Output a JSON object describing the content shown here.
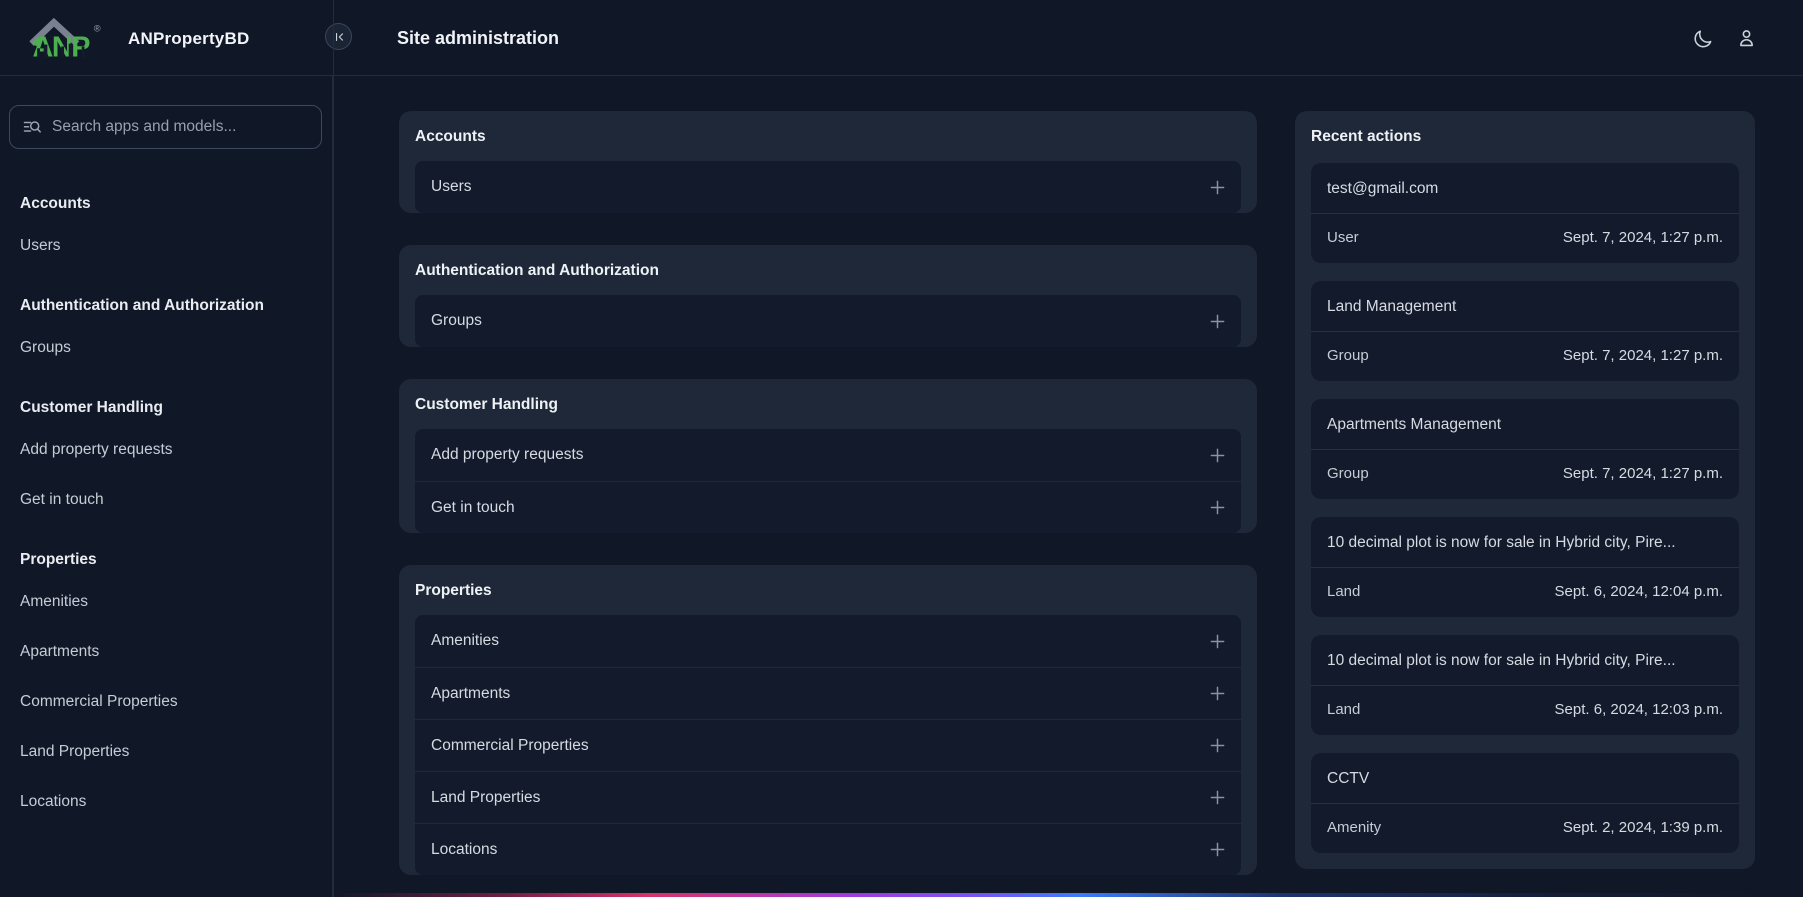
{
  "header": {
    "brand": "ANPropertyBD",
    "page_title": "Site administration",
    "icons": {
      "collapse": "collapse-sidebar",
      "theme": "moon",
      "account": "person"
    }
  },
  "logo": {
    "text": "ANP",
    "trademark": "®",
    "green": "#4caf50",
    "gray": "#7a8290"
  },
  "sidebar": {
    "search_placeholder": "Search apps and models...",
    "search_icon": "manage-search",
    "sections": [
      {
        "label": "Accounts",
        "items": [
          "Users"
        ]
      },
      {
        "label": "Authentication and Authorization",
        "items": [
          "Groups"
        ]
      },
      {
        "label": "Customer Handling",
        "items": [
          "Add property requests",
          "Get in touch"
        ]
      },
      {
        "label": "Properties",
        "items": [
          "Amenities",
          "Apartments",
          "Commercial Properties",
          "Land Properties",
          "Locations"
        ]
      }
    ]
  },
  "main": {
    "add_icon": "plus",
    "cards": [
      {
        "title": "Accounts",
        "rows": [
          "Users"
        ]
      },
      {
        "title": "Authentication and Authorization",
        "rows": [
          "Groups"
        ]
      },
      {
        "title": "Customer Handling",
        "rows": [
          "Add property requests",
          "Get in touch"
        ]
      },
      {
        "title": "Properties",
        "rows": [
          "Amenities",
          "Apartments",
          "Commercial Properties",
          "Land Properties",
          "Locations"
        ]
      }
    ]
  },
  "recent": {
    "title": "Recent actions",
    "entries": [
      {
        "title": "test@gmail.com",
        "type": "User",
        "time": "Sept. 7, 2024, 1:27 p.m."
      },
      {
        "title": "Land Management",
        "type": "Group",
        "time": "Sept. 7, 2024, 1:27 p.m."
      },
      {
        "title": "Apartments Management",
        "type": "Group",
        "time": "Sept. 7, 2024, 1:27 p.m."
      },
      {
        "title": "10 decimal plot is now for sale in Hybrid city, Pire...",
        "type": "Land",
        "time": "Sept. 6, 2024, 12:04 p.m."
      },
      {
        "title": "10 decimal plot is now for sale in Hybrid city, Pire...",
        "type": "Land",
        "time": "Sept. 6, 2024, 12:03 p.m."
      },
      {
        "title": "CCTV",
        "type": "Amenity",
        "time": "Sept. 2, 2024, 1:39 p.m."
      }
    ]
  },
  "colors": {
    "brand_green": "#4caf50",
    "accent_pink": "#d6336c",
    "accent_purple": "#7b52f0",
    "accent_blue": "#3d7bfa"
  }
}
